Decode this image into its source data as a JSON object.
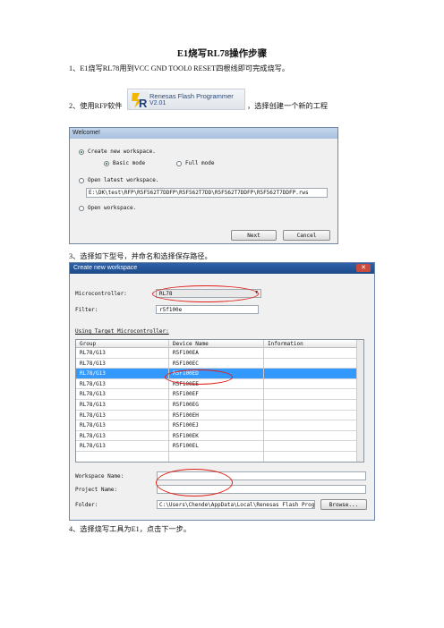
{
  "document": {
    "title": "E1烧写RL78操作步骤",
    "step1": "1、E1烧写RL78用到VCC GND TOOL0 RESET四根线即可完成烧写。",
    "step2_prefix": "2、使用RFP软件",
    "step2_suffix": "，选择创建一个新的工程",
    "step3": "3、选择如下型号，并命名和选择保存路径。",
    "step4": "4、选择烧写工具为E1，点击下一步。"
  },
  "rfp_logo": {
    "name": "Renesas Flash Programmer",
    "version": "V2.01",
    "icon": "renesas-r-icon"
  },
  "welcome_dialog": {
    "title": "Welcome!",
    "create_new": "Create new workspace.",
    "basic_mode": "Basic mode",
    "full_mode": "Full mode",
    "open_latest": "Open latest workspace.",
    "latest_path": "E:\\DK\\test\\RFP\\R5F562T7DDFP\\R5F562T7DD\\R5F562T7DDFP\\R5F562T7DDFP.rws",
    "open_workspace": "Open workspace.",
    "next_label": "Next",
    "cancel_label": "Cancel",
    "selected_option": "Create new workspace.",
    "selected_mode": "Basic mode"
  },
  "new_workspace_dialog": {
    "title": "Create new workspace",
    "close_icon": "close-icon",
    "microcontroller_label": "Microcontroller:",
    "microcontroller_value": "RL78",
    "filter_label": "Filter:",
    "filter_value": "r5f100e",
    "using_target_label": "Using Target Microcontroller:",
    "columns": [
      "Group",
      "Device Name",
      "Information"
    ],
    "rows": [
      {
        "group": "RL78/G13",
        "device": "R5F100EA"
      },
      {
        "group": "RL78/G13",
        "device": "R5F100EC"
      },
      {
        "group": "RL78/G13",
        "device": "R5F100ED"
      },
      {
        "group": "RL78/G13",
        "device": "R5F100EE"
      },
      {
        "group": "RL78/G13",
        "device": "R5F100EF"
      },
      {
        "group": "RL78/G13",
        "device": "R5F100EG"
      },
      {
        "group": "RL78/G13",
        "device": "R5F100EH"
      },
      {
        "group": "RL78/G13",
        "device": "R5F100EJ"
      },
      {
        "group": "RL78/G13",
        "device": "R5F100EK"
      },
      {
        "group": "RL78/G13",
        "device": "R5F100EL"
      }
    ],
    "selected_row": "R5F100ED",
    "workspace_name_label": "Workspace Name:",
    "project_name_label": "Project Name:",
    "folder_label": "Folder:",
    "folder_value": "C:\\Users\\Chende\\AppData\\Local\\Renesas Flash Prog",
    "browse_label": "Browse..."
  },
  "colors": {
    "selection": "#3399ff",
    "annotation_oval": "#e0201a",
    "title_bar": "#1d4a8a"
  }
}
